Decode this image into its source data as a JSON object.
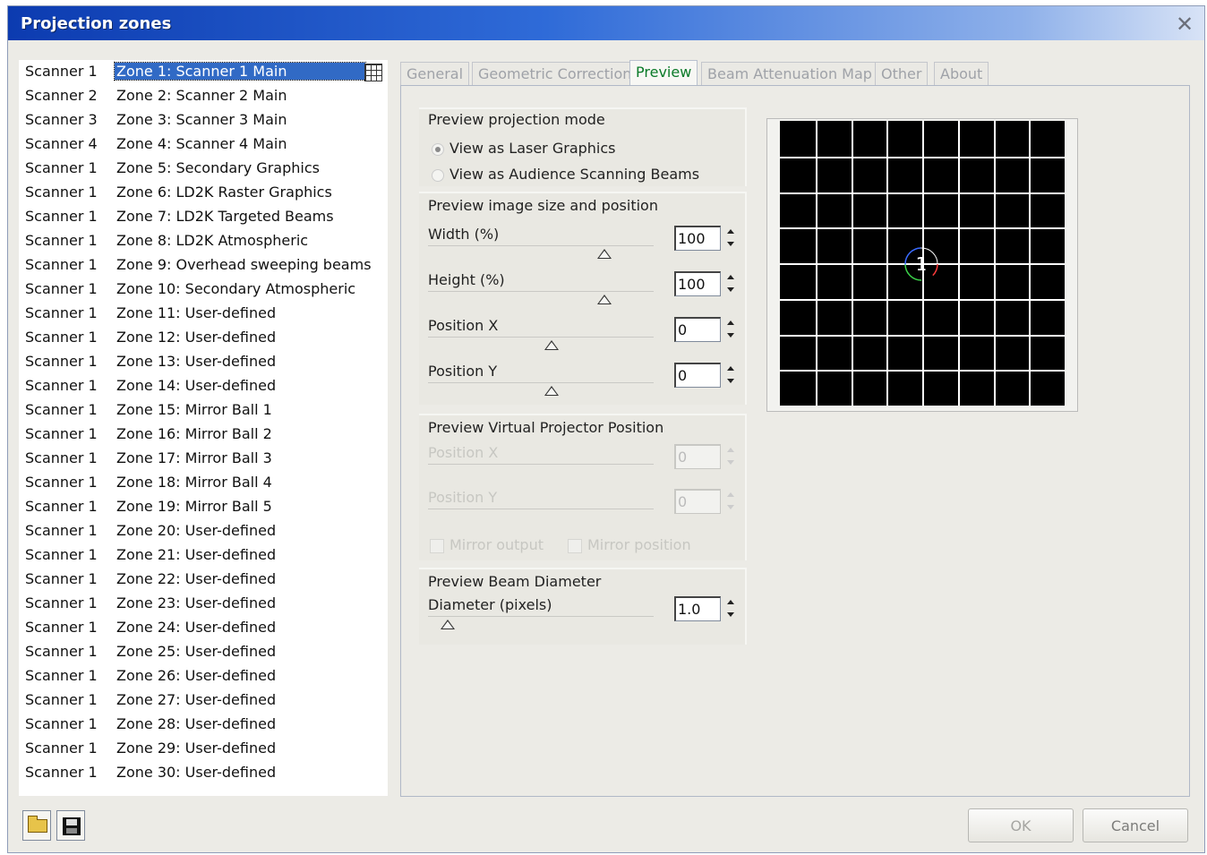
{
  "window": {
    "title": "Projection zones"
  },
  "zones": [
    {
      "scanner": "Scanner 1",
      "zone": "Zone 1: Scanner 1 Main"
    },
    {
      "scanner": "Scanner 2",
      "zone": "Zone 2: Scanner 2 Main"
    },
    {
      "scanner": "Scanner 3",
      "zone": "Zone 3: Scanner 3 Main"
    },
    {
      "scanner": "Scanner 4",
      "zone": "Zone 4: Scanner 4 Main"
    },
    {
      "scanner": "Scanner 1",
      "zone": "Zone 5: Secondary Graphics"
    },
    {
      "scanner": "Scanner 1",
      "zone": "Zone 6: LD2K Raster Graphics"
    },
    {
      "scanner": "Scanner 1",
      "zone": "Zone 7: LD2K Targeted Beams"
    },
    {
      "scanner": "Scanner 1",
      "zone": "Zone 8: LD2K Atmospheric"
    },
    {
      "scanner": "Scanner 1",
      "zone": "Zone 9: Overhead sweeping beams"
    },
    {
      "scanner": "Scanner 1",
      "zone": "Zone 10: Secondary Atmospheric"
    },
    {
      "scanner": "Scanner 1",
      "zone": "Zone 11: User-defined"
    },
    {
      "scanner": "Scanner 1",
      "zone": "Zone 12: User-defined"
    },
    {
      "scanner": "Scanner 1",
      "zone": "Zone 13: User-defined"
    },
    {
      "scanner": "Scanner 1",
      "zone": "Zone 14: User-defined"
    },
    {
      "scanner": "Scanner 1",
      "zone": "Zone 15: Mirror Ball 1"
    },
    {
      "scanner": "Scanner 1",
      "zone": "Zone 16: Mirror Ball 2"
    },
    {
      "scanner": "Scanner 1",
      "zone": "Zone 17: Mirror Ball 3"
    },
    {
      "scanner": "Scanner 1",
      "zone": "Zone 18: Mirror Ball 4"
    },
    {
      "scanner": "Scanner 1",
      "zone": "Zone 19: Mirror Ball 5"
    },
    {
      "scanner": "Scanner 1",
      "zone": "Zone 20: User-defined"
    },
    {
      "scanner": "Scanner 1",
      "zone": "Zone 21: User-defined"
    },
    {
      "scanner": "Scanner 1",
      "zone": "Zone 22: User-defined"
    },
    {
      "scanner": "Scanner 1",
      "zone": "Zone 23: User-defined"
    },
    {
      "scanner": "Scanner 1",
      "zone": "Zone 24: User-defined"
    },
    {
      "scanner": "Scanner 1",
      "zone": "Zone 25: User-defined"
    },
    {
      "scanner": "Scanner 1",
      "zone": "Zone 26: User-defined"
    },
    {
      "scanner": "Scanner 1",
      "zone": "Zone 27: User-defined"
    },
    {
      "scanner": "Scanner 1",
      "zone": "Zone 28: User-defined"
    },
    {
      "scanner": "Scanner 1",
      "zone": "Zone 29: User-defined"
    },
    {
      "scanner": "Scanner 1",
      "zone": "Zone 30: User-defined"
    }
  ],
  "tabs": [
    "General",
    "Geometric Correction",
    "Preview",
    "Beam Attenuation Map",
    "Other",
    "About"
  ],
  "active_tab": "Preview",
  "mode": {
    "heading": "Preview projection mode",
    "option_laser": "View as Laser Graphics",
    "option_audience": "View as Audience Scanning Beams",
    "selected": "View as Laser Graphics"
  },
  "size": {
    "heading": "Preview image size and position",
    "width_label": "Width (%)",
    "width_value": "100",
    "height_label": "Height (%)",
    "height_value": "100",
    "posx_label": "Position X",
    "posx_value": "0",
    "posy_label": "Position Y",
    "posy_value": "0"
  },
  "virtual": {
    "heading": "Preview Virtual Projector Position",
    "posx_label": "Position X",
    "posx_value": "0",
    "posy_label": "Position Y",
    "posy_value": "0",
    "mirror_output": "Mirror output",
    "mirror_position": "Mirror position"
  },
  "beam": {
    "heading": "Preview Beam Diameter",
    "diameter_label": "Diameter (pixels)",
    "diameter_value": "1.0"
  },
  "preview": {
    "zone_number": "1",
    "background": "#000000",
    "grid_color": "#ffffff"
  },
  "buttons": {
    "ok": "OK",
    "cancel": "Cancel"
  },
  "colors": {
    "selection": "#316ac5",
    "active_tab_text": "#0a7a28"
  }
}
